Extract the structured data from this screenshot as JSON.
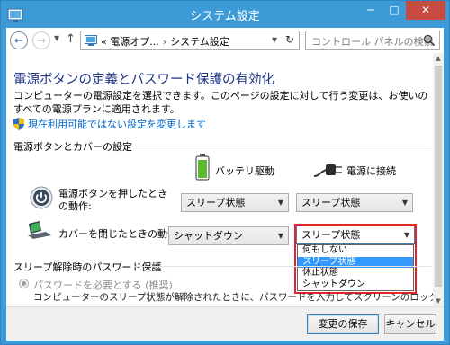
{
  "window": {
    "title": "システム設定",
    "controls": {
      "minimize": "─",
      "maximize": "□",
      "close": "✕"
    }
  },
  "address": {
    "path_prefix": "«",
    "crumb1": "電源オプ...",
    "separator": "›",
    "crumb2": "システム設定",
    "search_placeholder": "コントロール パネルの検索"
  },
  "main": {
    "heading": "電源ボタンの定義とパスワード保護の有効化",
    "description": "コンピューターの電源設定を選択できます。このページの設定に対して行う変更は、お使いのすべての電源プランに適用されます。",
    "change_link": "現在利用可能ではない設定を変更します",
    "section1": "電源ボタンとカバーの設定",
    "col_battery": "バッテリ駆動",
    "col_plugged": "電源に接続",
    "row_power_label": "電源ボタンを押したときの動作:",
    "row_lid_label": "カバーを閉じたときの動作:",
    "power_battery": "スリープ状態",
    "power_plugged": "スリープ状態",
    "lid_battery": "シャットダウン",
    "lid_plugged": "スリープ状態",
    "dropdown_options": [
      "何もしない",
      "スリープ状態",
      "休止状態",
      "シャットダウン"
    ],
    "dropdown_selected_index": 1,
    "section2": "スリープ解除時のパスワード保護",
    "radio_label": "パスワードを必要とする (推奨)",
    "radio_desc": "コンピューターのスリープ状態が解除されたときに、パスワードを入力してスクリーンのロックを解除しない限"
  },
  "footer": {
    "save": "変更の保存",
    "cancel": "キャンセル"
  },
  "colors": {
    "titlebar": "#3c9bd6",
    "close_button": "#c74b43",
    "heading": "#1e3287",
    "link": "#0066cc",
    "highlight_box": "#e3242b",
    "selected_option": "#3399ff"
  },
  "icons": [
    "app-icon",
    "back-arrow-icon",
    "forward-arrow-icon",
    "up-arrow-icon",
    "refresh-icon",
    "search-icon",
    "shield-icon",
    "battery-icon",
    "plug-icon",
    "power-button-icon",
    "laptop-lid-icon"
  ]
}
